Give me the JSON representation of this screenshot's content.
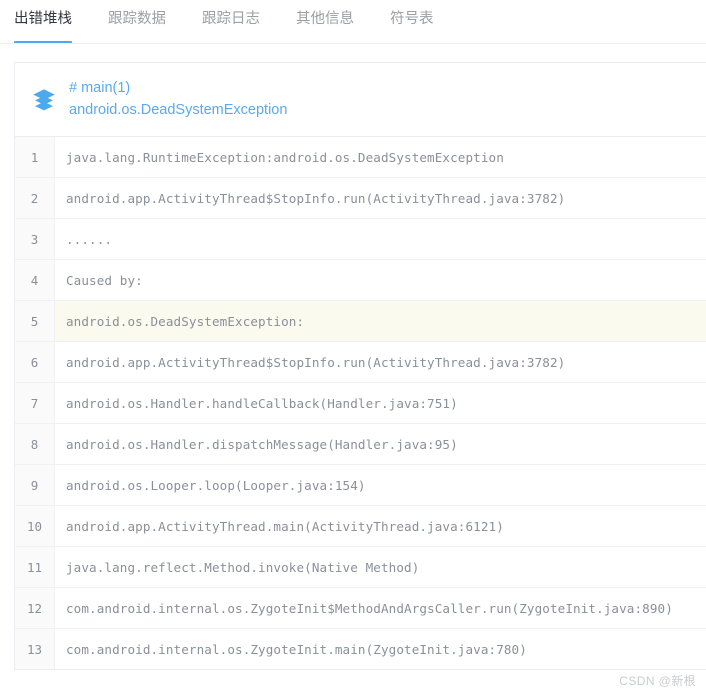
{
  "tabs": [
    {
      "label": "出错堆栈",
      "active": true
    },
    {
      "label": "跟踪数据",
      "active": false
    },
    {
      "label": "跟踪日志",
      "active": false
    },
    {
      "label": "其他信息",
      "active": false
    },
    {
      "label": "符号表",
      "active": false
    }
  ],
  "card_header": {
    "icon": "layers-stack-icon",
    "thread_name": "# main(1)",
    "exception_name": "android.os.DeadSystemException",
    "link_color": "#5aa9f0"
  },
  "stack_trace": {
    "highlighted_line": 5,
    "highlight_color": "#fbfaef",
    "text_color": "#8a9099",
    "lines": [
      {
        "n": "1",
        "text": "java.lang.RuntimeException:android.os.DeadSystemException"
      },
      {
        "n": "2",
        "text": "android.app.ActivityThread$StopInfo.run(ActivityThread.java:3782)"
      },
      {
        "n": "3",
        "text": "......"
      },
      {
        "n": "4",
        "text": "Caused by:"
      },
      {
        "n": "5",
        "text": "android.os.DeadSystemException:"
      },
      {
        "n": "6",
        "text": "android.app.ActivityThread$StopInfo.run(ActivityThread.java:3782)"
      },
      {
        "n": "7",
        "text": "android.os.Handler.handleCallback(Handler.java:751)"
      },
      {
        "n": "8",
        "text": "android.os.Handler.dispatchMessage(Handler.java:95)"
      },
      {
        "n": "9",
        "text": "android.os.Looper.loop(Looper.java:154)"
      },
      {
        "n": "10",
        "text": "android.app.ActivityThread.main(ActivityThread.java:6121)"
      },
      {
        "n": "11",
        "text": "java.lang.reflect.Method.invoke(Native Method)"
      },
      {
        "n": "12",
        "text": "com.android.internal.os.ZygoteInit$MethodAndArgsCaller.run(ZygoteInit.java:890)"
      },
      {
        "n": "13",
        "text": "com.android.internal.os.ZygoteInit.main(ZygoteInit.java:780)"
      }
    ]
  },
  "watermark": {
    "text": "CSDN @新根"
  },
  "theme": {
    "accent": "#4ba9ec",
    "border": "#ebedf0",
    "gutter_bg": "#fafafa"
  }
}
